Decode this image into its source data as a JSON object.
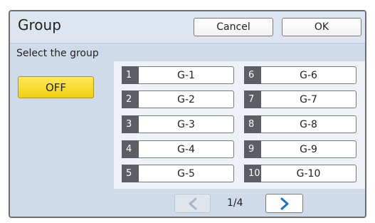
{
  "dialog": {
    "title": "Group",
    "cancel_label": "Cancel",
    "ok_label": "OK",
    "subtitle": "Select the group",
    "off_label": "OFF"
  },
  "groups": [
    {
      "num": "1",
      "label": "G-1"
    },
    {
      "num": "2",
      "label": "G-2"
    },
    {
      "num": "3",
      "label": "G-3"
    },
    {
      "num": "4",
      "label": "G-4"
    },
    {
      "num": "5",
      "label": "G-5"
    },
    {
      "num": "6",
      "label": "G-6"
    },
    {
      "num": "7",
      "label": "G-7"
    },
    {
      "num": "8",
      "label": "G-8"
    },
    {
      "num": "9",
      "label": "G-9"
    },
    {
      "num": "10",
      "label": "G-10"
    }
  ],
  "pager": {
    "indicator": "1/4",
    "prev_icon": "chevron-left-icon",
    "next_icon": "chevron-right-icon"
  },
  "colors": {
    "off_button": "#f2cf10",
    "number_badge": "#5b5e63",
    "accent_arrow": "#1a73c8",
    "disabled_arrow": "#a9b8c9"
  }
}
